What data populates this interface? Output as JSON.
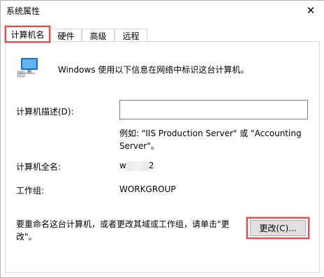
{
  "window": {
    "title": "系统属性",
    "close_glyph": "✕"
  },
  "tabs": [
    {
      "label": "计算机名",
      "active": true
    },
    {
      "label": "硬件",
      "active": false
    },
    {
      "label": "高级",
      "active": false
    },
    {
      "label": "远程",
      "active": false
    }
  ],
  "intro": {
    "icon": "computer-icon",
    "text": "Windows 使用以下信息在网络中标识这台计算机。"
  },
  "description": {
    "label": "计算机描述(D):",
    "value": "",
    "example_line1": "例如: \"IIS Production Server\" 或 \"Accounting",
    "example_line2": "Server\"。"
  },
  "full_name": {
    "label": "计算机全名:",
    "value_prefix": "w",
    "value_suffix": "2"
  },
  "workgroup": {
    "label": "工作组:",
    "value": "WORKGROUP"
  },
  "rename": {
    "text_line1": "要重命名这台计算机，或者更改其域或工作组，请单击\"更",
    "text_line2": "改\"。",
    "button_label": "更改(C)..."
  },
  "colors": {
    "highlight": "#e05050",
    "border": "#d9d9d9"
  }
}
